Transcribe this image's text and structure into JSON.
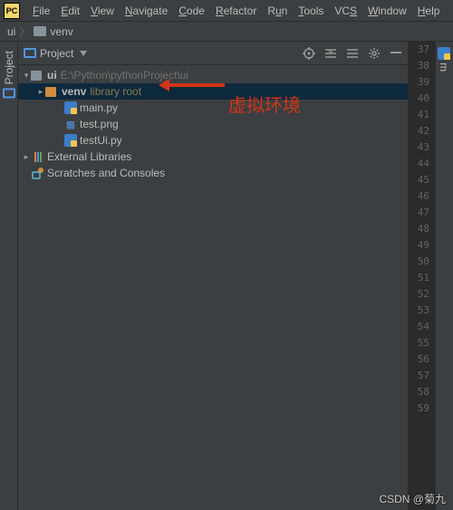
{
  "menu": {
    "items": [
      "File",
      "Edit",
      "View",
      "Navigate",
      "Code",
      "Refactor",
      "Run",
      "Tools",
      "VCS",
      "Window",
      "Help"
    ]
  },
  "nav": {
    "crumb1": "ui",
    "crumb2": "venv"
  },
  "panel": {
    "title": "Project"
  },
  "tree": {
    "root_name": "ui",
    "root_path": "E:\\Python\\pythonProject\\ui",
    "venv_name": "venv",
    "venv_tag": "library root",
    "file_main": "main.py",
    "file_test_png": "test.png",
    "file_test_ui": "testUi.py",
    "ext_libs": "External Libraries",
    "scratches": "Scratches and Consoles"
  },
  "lines": {
    "start": 37,
    "end": 59
  },
  "side": {
    "project_tab": "Project",
    "right_tab": "m"
  },
  "annotation": {
    "text": "虚拟环境"
  },
  "watermark": "CSDN @菊九"
}
